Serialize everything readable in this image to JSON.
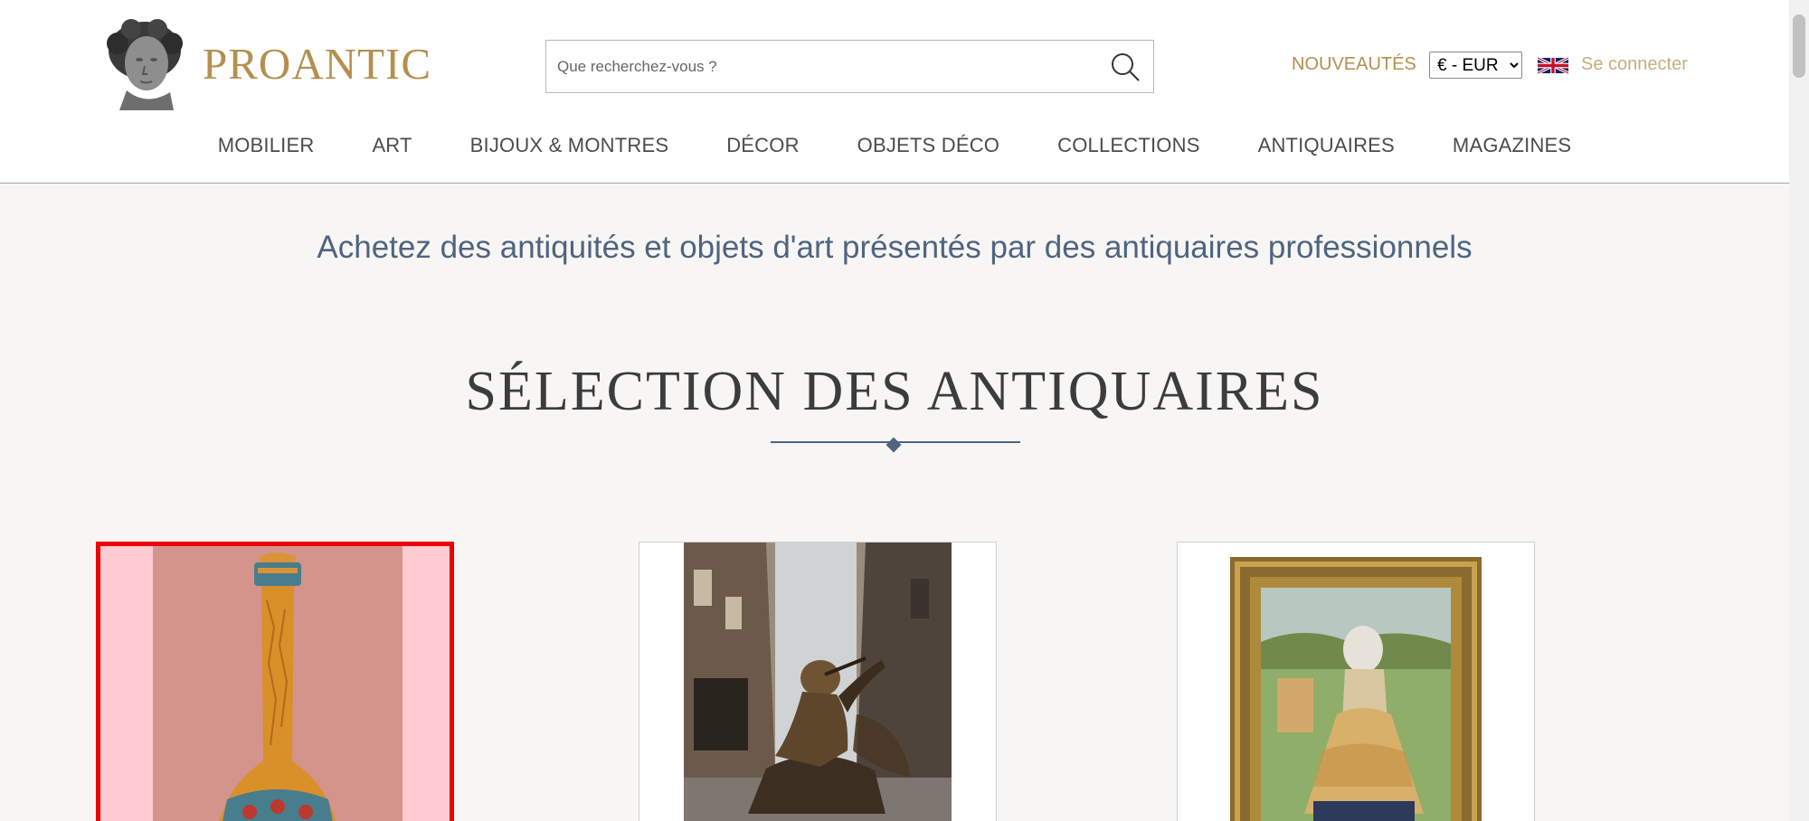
{
  "brand": {
    "name": "PROANTIC"
  },
  "search": {
    "placeholder": "Que recherchez-vous ?"
  },
  "header_links": {
    "new": "NOUVEAUTÉS",
    "login": "Se connecter"
  },
  "currency": {
    "selected": "€ - EUR"
  },
  "nav": {
    "items": [
      "MOBILIER",
      "ART",
      "BIJOUX & MONTRES",
      "DÉCOR",
      "OBJETS DÉCO",
      "COLLECTIONS",
      "ANTIQUAIRES",
      "MAGAZINES"
    ]
  },
  "tagline": "Achetez des antiquités et objets d'art présentés par des antiquaires professionnels",
  "section": {
    "title": "SÉLECTION DES ANTIQUAIRES"
  },
  "products": [
    {
      "kind": "enamel-vase-photo"
    },
    {
      "kind": "bronze-statue-photo"
    },
    {
      "kind": "framed-painting-photo"
    }
  ],
  "colors": {
    "gold": "#b48f4e",
    "blue": "#4f6480",
    "highlight": "#ee0000"
  }
}
